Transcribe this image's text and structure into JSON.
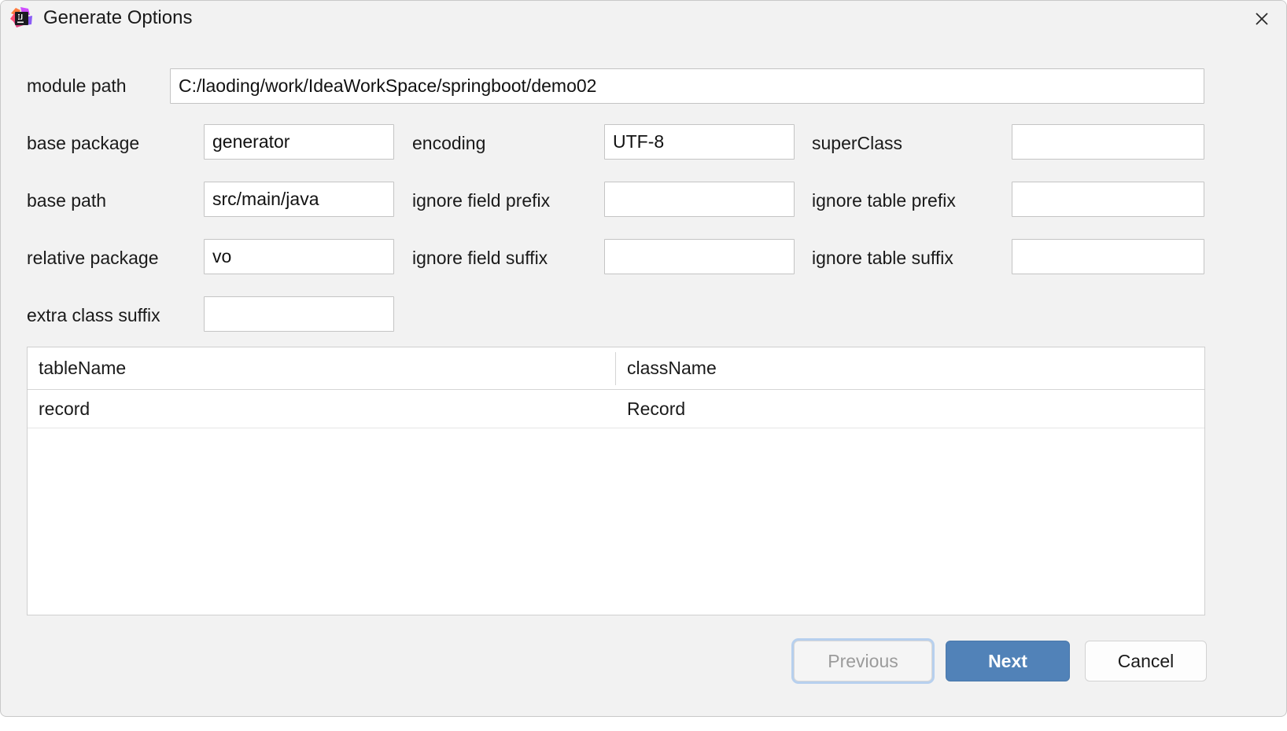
{
  "window": {
    "title": "Generate Options",
    "icon": "intellij-idea-icon",
    "close_icon": "close-icon",
    "background_color": "#f2f2f2"
  },
  "form": {
    "fields": [
      {
        "label": "module path",
        "value": "C:/laoding/work/IdeaWorkSpace/springboot/demo02",
        "placeholder": ""
      },
      {
        "label": "base package",
        "value": "generator",
        "placeholder": ""
      },
      {
        "label": "encoding",
        "value": "UTF-8",
        "placeholder": ""
      },
      {
        "label": "superClass",
        "value": "",
        "placeholder": ""
      },
      {
        "label": "base path",
        "value": "src/main/java",
        "placeholder": ""
      },
      {
        "label": "ignore field prefix",
        "value": "",
        "placeholder": ""
      },
      {
        "label": "ignore table prefix",
        "value": "",
        "placeholder": ""
      },
      {
        "label": "relative package",
        "value": "vo",
        "placeholder": ""
      },
      {
        "label": "ignore field suffix",
        "value": "",
        "placeholder": ""
      },
      {
        "label": "ignore table suffix",
        "value": "",
        "placeholder": ""
      },
      {
        "label": "extra class suffix",
        "value": "",
        "placeholder": ""
      }
    ]
  },
  "table": {
    "columns": [
      "tableName",
      "className"
    ],
    "rows": [
      {
        "tableName": "record",
        "className": "Record"
      }
    ]
  },
  "buttons": {
    "previous": {
      "label": "Previous",
      "enabled": false,
      "focused": true
    },
    "next": {
      "label": "Next",
      "enabled": true,
      "primary": true
    },
    "cancel": {
      "label": "Cancel",
      "enabled": true
    }
  },
  "colors": {
    "primary_button": "#5182b8",
    "focus_ring": "#b7d0ee",
    "dialog_bg": "#f2f2f2",
    "field_bg": "#ffffff",
    "field_border": "#c4c4c4",
    "disabled_text": "#9b9b9b"
  },
  "background_window": {
    "clipped_text": ""
  }
}
